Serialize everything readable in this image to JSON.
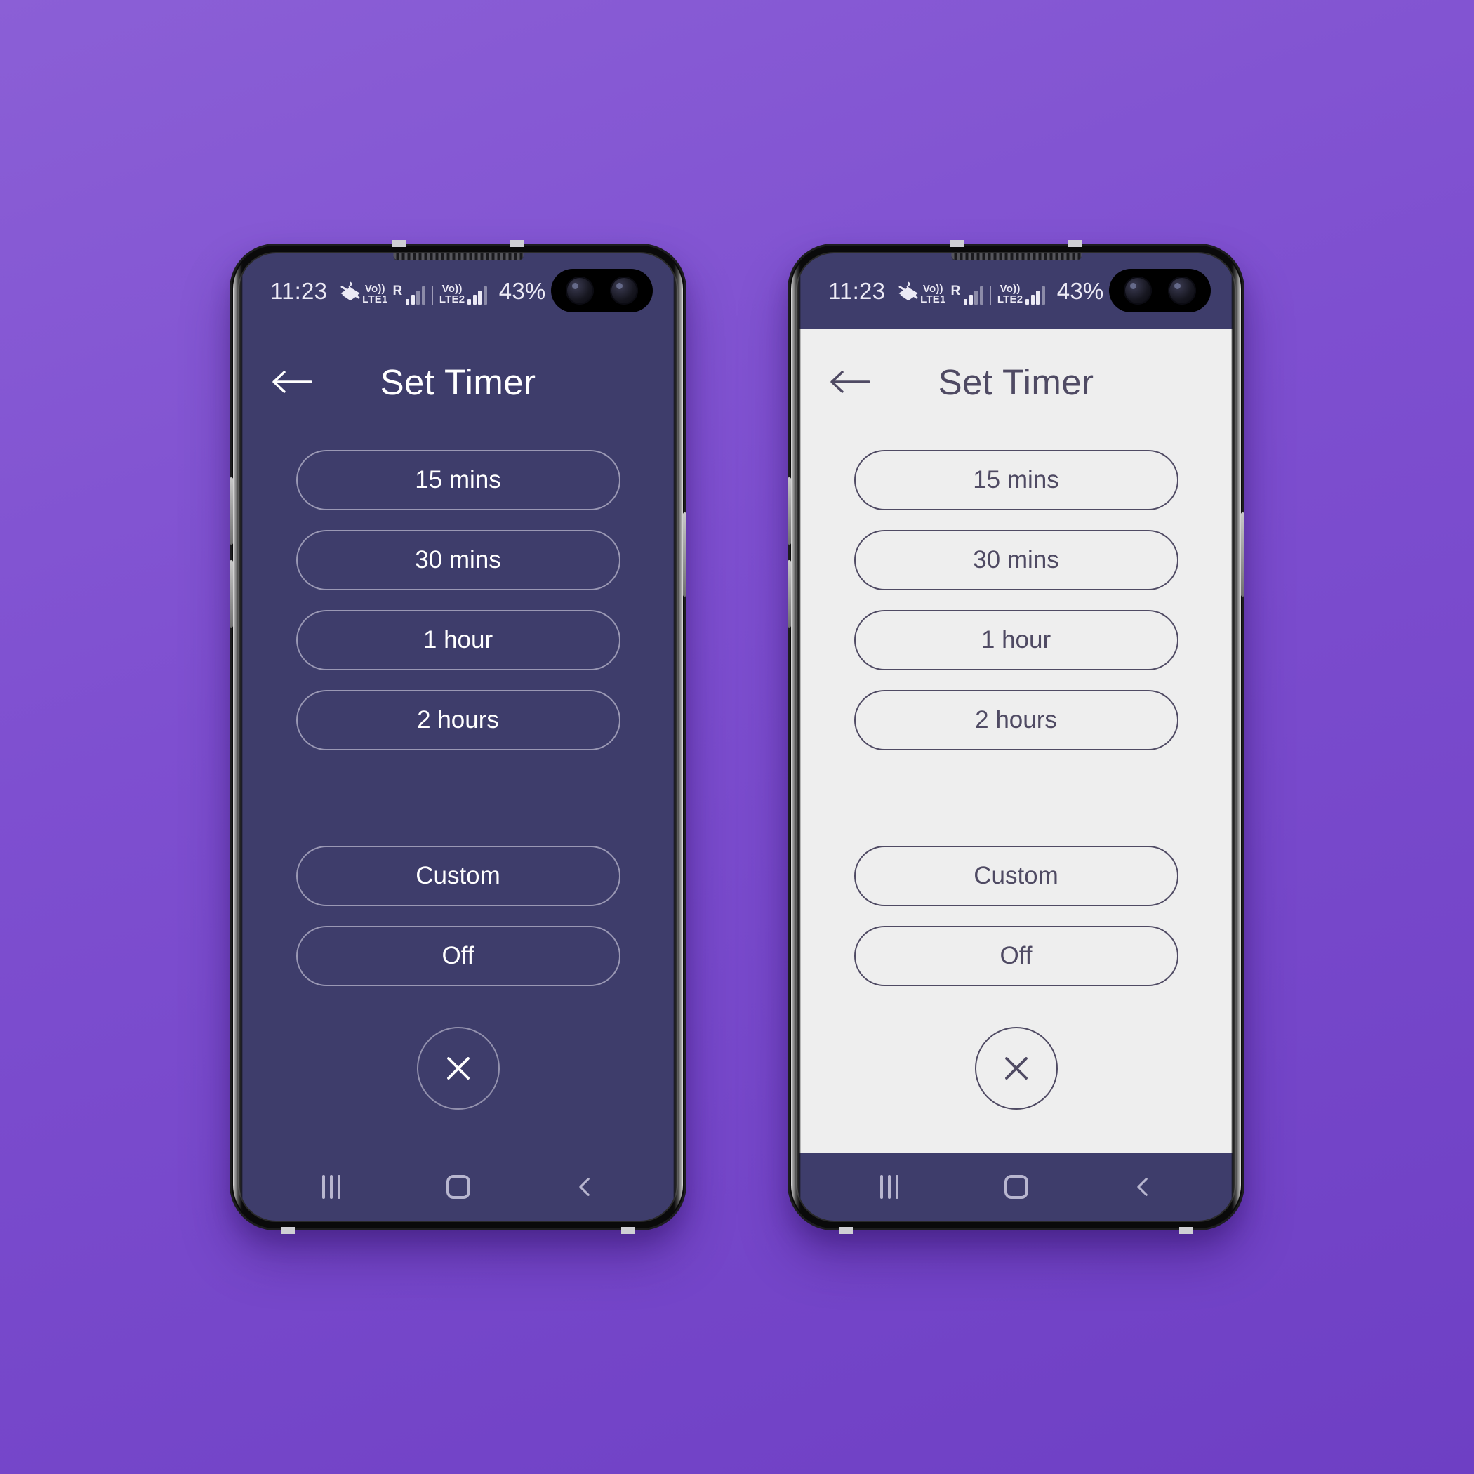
{
  "background_color": "#7b4fd0",
  "devices": [
    {
      "variant": "dark",
      "theme_bg": "#3e3d6b",
      "theme_fg": "#ffffff",
      "status_bar": {
        "clock": "11:23",
        "mute_icon": "vibrate-mute-icon",
        "sim1_label": "Vo))",
        "sim1_network": "LTE1",
        "roaming": "R",
        "sim2_label": "Vo))",
        "sim2_network": "LTE2",
        "battery_percent": "43%",
        "battery_icon": "battery-icon"
      },
      "app": {
        "back_icon": "back-arrow-icon",
        "title": "Set Timer",
        "options": [
          "15 mins",
          "30 mins",
          "1 hour",
          "2 hours"
        ],
        "secondary_options": [
          "Custom",
          "Off"
        ],
        "close_icon": "close-icon"
      },
      "nav_bar": {
        "recents_icon": "recents-icon",
        "home_icon": "home-icon",
        "back_icon": "nav-back-icon"
      }
    },
    {
      "variant": "light",
      "theme_bg": "#eeeeee",
      "theme_fg": "#4f4a63",
      "status_bar": {
        "clock": "11:23",
        "mute_icon": "vibrate-mute-icon",
        "sim1_label": "Vo))",
        "sim1_network": "LTE1",
        "roaming": "R",
        "sim2_label": "Vo))",
        "sim2_network": "LTE2",
        "battery_percent": "43%",
        "battery_icon": "battery-icon"
      },
      "app": {
        "back_icon": "back-arrow-icon",
        "title": "Set Timer",
        "options": [
          "15 mins",
          "30 mins",
          "1 hour",
          "2 hours"
        ],
        "secondary_options": [
          "Custom",
          "Off"
        ],
        "close_icon": "close-icon"
      },
      "nav_bar": {
        "recents_icon": "recents-icon",
        "home_icon": "home-icon",
        "back_icon": "nav-back-icon"
      }
    }
  ]
}
